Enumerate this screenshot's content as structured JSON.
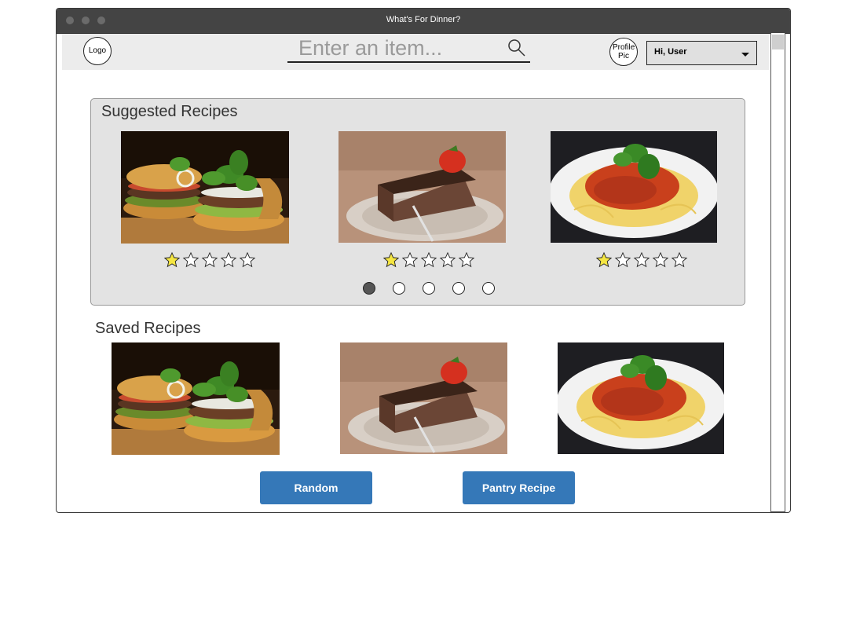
{
  "window": {
    "title": "What's For Dinner?"
  },
  "header": {
    "logo_label": "Logo",
    "search_placeholder": "Enter an item...",
    "profile_label": "Profile Pic",
    "user_menu_label": "Hi, User"
  },
  "suggested": {
    "title": "Suggested Recipes",
    "recipes": [
      {
        "image": "burger",
        "rating": 1,
        "max_rating": 5
      },
      {
        "image": "chocolate-cake",
        "rating": 1,
        "max_rating": 5
      },
      {
        "image": "spaghetti",
        "rating": 1,
        "max_rating": 5
      }
    ],
    "pager": {
      "pages": 5,
      "active": 1
    }
  },
  "saved": {
    "title": "Saved Recipes",
    "recipes": [
      {
        "image": "burger"
      },
      {
        "image": "chocolate-cake"
      },
      {
        "image": "spaghetti"
      }
    ]
  },
  "buttons": {
    "random_label": "Random",
    "pantry_label": "Pantry Recipe"
  },
  "colors": {
    "accent": "#3578b8",
    "star_filled": "#f5e642"
  }
}
